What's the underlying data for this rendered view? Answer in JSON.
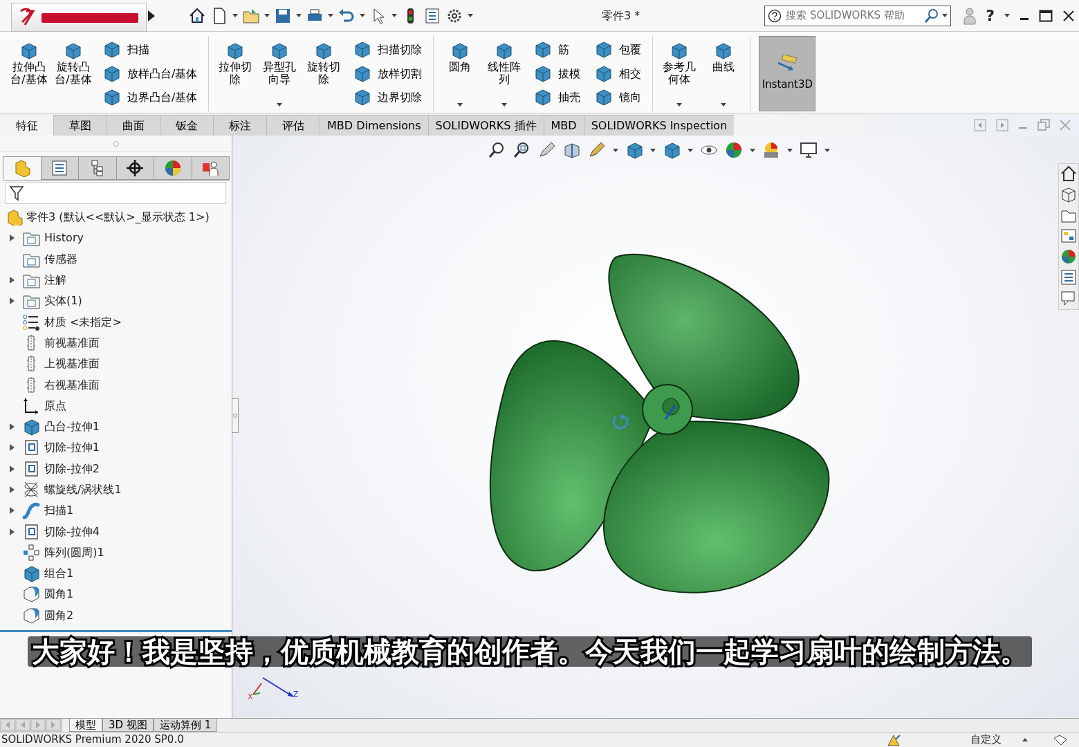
{
  "title": "零件3 *",
  "search": {
    "placeholder": "搜索 SOLIDWORKS 帮助"
  },
  "help": "?",
  "ribbon": [
    {
      "kind": "large",
      "label": "拉伸凸台/基体",
      "dropdown": false
    },
    {
      "kind": "large",
      "label": "旋转凸台/基体",
      "dropdown": false
    },
    {
      "kind": "stack",
      "items": [
        "扫描",
        "放样凸台/基体",
        "边界凸台/基体"
      ]
    },
    {
      "kind": "large",
      "label": "拉伸切除",
      "dropdown": false
    },
    {
      "kind": "large",
      "label": "异型孔向导",
      "dropdown": true
    },
    {
      "kind": "large",
      "label": "旋转切除",
      "dropdown": false
    },
    {
      "kind": "stack",
      "items": [
        "扫描切除",
        "放样切割",
        "边界切除"
      ]
    },
    {
      "kind": "large",
      "label": "圆角",
      "dropdown": true
    },
    {
      "kind": "large",
      "label": "线性阵列",
      "dropdown": true
    },
    {
      "kind": "stack",
      "items": [
        "筋",
        "拔模",
        "抽壳"
      ]
    },
    {
      "kind": "stack",
      "items": [
        "包覆",
        "相交",
        "镜向"
      ]
    },
    {
      "kind": "large",
      "label": "参考几何体",
      "dropdown": true
    },
    {
      "kind": "large",
      "label": "曲线",
      "dropdown": true
    },
    {
      "kind": "toggle",
      "label": "Instant3D",
      "on": true
    }
  ],
  "tabs": [
    {
      "label": "特征",
      "selected": true
    },
    {
      "label": "草图",
      "selected": false
    },
    {
      "label": "曲面",
      "selected": false
    },
    {
      "label": "钣金",
      "selected": false
    },
    {
      "label": "标注",
      "selected": false
    },
    {
      "label": "评估",
      "selected": false
    },
    {
      "label": "MBD Dimensions",
      "selected": false
    },
    {
      "label": "SOLIDWORKS 插件",
      "selected": false
    },
    {
      "label": "MBD",
      "selected": false
    },
    {
      "label": "SOLIDWORKS Inspection",
      "selected": false
    }
  ],
  "panel_tabs": [
    {
      "selected": true
    },
    {
      "selected": false
    },
    {
      "selected": false
    },
    {
      "selected": false
    },
    {
      "selected": false
    },
    {
      "selected": false
    }
  ],
  "tree": {
    "root": "零件3 (默认<<默认>_显示状态 1>)",
    "items": [
      {
        "label": "History",
        "kind": "folder",
        "collapsible": true
      },
      {
        "label": "传感器",
        "kind": "folder",
        "collapsible": false
      },
      {
        "label": "注解",
        "kind": "folder",
        "collapsible": true
      },
      {
        "label": "实体(1)",
        "kind": "folder",
        "collapsible": true
      },
      {
        "label": "材质 <未指定>",
        "kind": "material",
        "collapsible": false
      },
      {
        "label": "前视基准面",
        "kind": "plane",
        "collapsible": false
      },
      {
        "label": "上视基准面",
        "kind": "plane",
        "collapsible": false
      },
      {
        "label": "右视基准面",
        "kind": "plane",
        "collapsible": false
      },
      {
        "label": "原点",
        "kind": "origin",
        "collapsible": false
      },
      {
        "label": "凸台-拉伸1",
        "kind": "boss",
        "collapsible": true
      },
      {
        "label": "切除-拉伸1",
        "kind": "cut",
        "collapsible": true
      },
      {
        "label": "切除-拉伸2",
        "kind": "cut",
        "collapsible": true
      },
      {
        "label": "螺旋线/涡状线1",
        "kind": "helix",
        "collapsible": true
      },
      {
        "label": "扫描1",
        "kind": "sweep",
        "collapsible": true
      },
      {
        "label": "切除-拉伸4",
        "kind": "cut",
        "collapsible": true
      },
      {
        "label": "阵列(圆周)1",
        "kind": "pattern",
        "collapsible": false
      },
      {
        "label": "组合1",
        "kind": "boss",
        "collapsible": false
      },
      {
        "label": "圆角1",
        "kind": "fillet",
        "collapsible": false
      },
      {
        "label": "圆角2",
        "kind": "fillet",
        "collapsible": false
      }
    ]
  },
  "triad": [
    "X",
    "Z"
  ],
  "subtitle": "大家好！我是坚持，优质机械教育的创作者。今天我们一起学习扇叶的绘制方法。",
  "bottom_tabs": [
    {
      "label": "模型",
      "selected": true
    },
    {
      "label": "3D 视图",
      "selected": false
    },
    {
      "label": "运动算例 1",
      "selected": false
    }
  ],
  "status_bar": {
    "product": "SOLIDWORKS Premium 2020 SP0.0",
    "units": "自定义"
  }
}
